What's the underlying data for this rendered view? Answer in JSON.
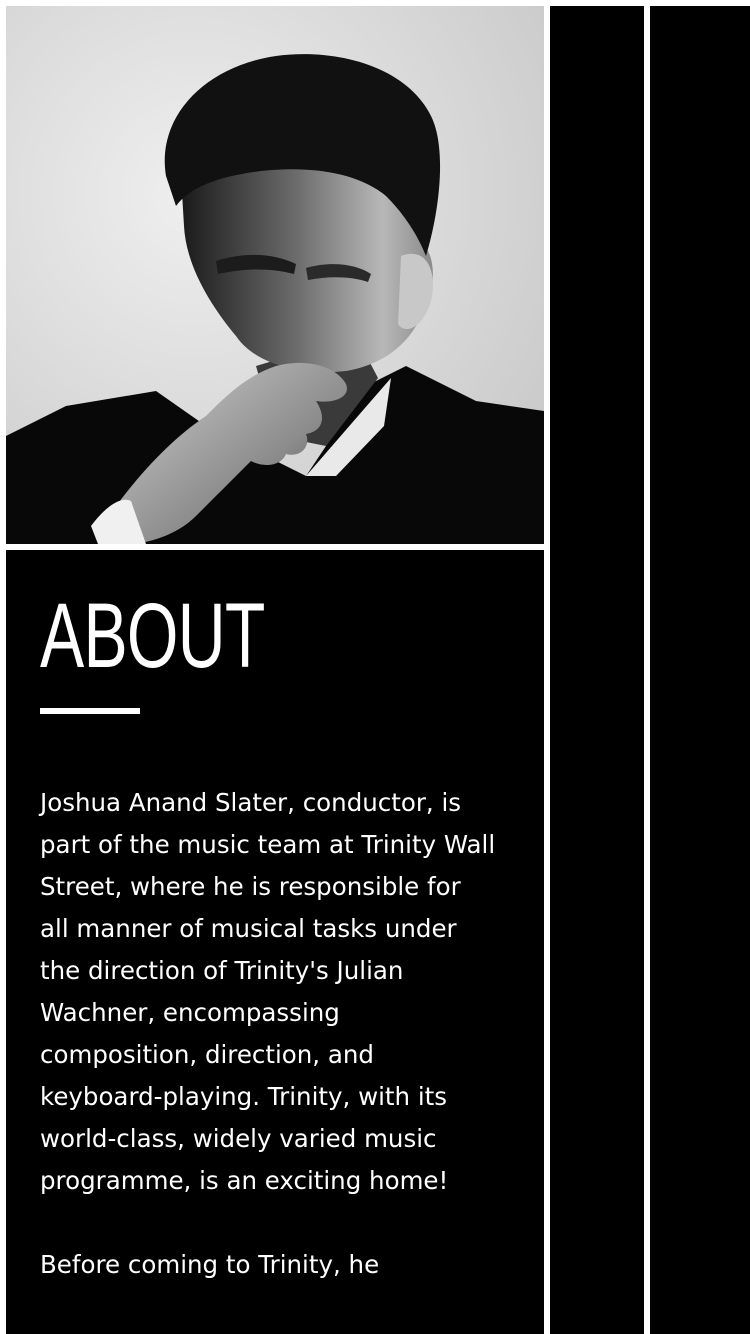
{
  "photo": {
    "alt": "Black and white portrait of a man resting his chin on his hand"
  },
  "about": {
    "heading": "ABOUT",
    "paragraphs": [
      "Joshua Anand Slater, conductor, is part of the music team at Trinity Wall Street, where he is responsible for all manner of musical tasks under the direction of Trinity's Julian Wachner, encompassing composition, direction, and keyboard-playing. Trinity, with its world-class, widely varied music programme, is an exciting home!",
      "Before coming to Trinity, he"
    ]
  },
  "colors": {
    "background": "#ffffff",
    "panel": "#000000",
    "text": "#ffffff"
  }
}
